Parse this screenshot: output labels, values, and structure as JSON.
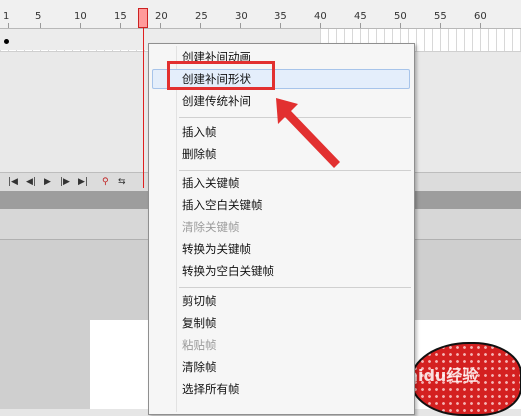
{
  "timeline": {
    "frame_numbers": [
      "1",
      "5",
      "10",
      "15",
      "20",
      "25",
      "30",
      "35",
      "40",
      "45",
      "50",
      "55",
      "60"
    ],
    "current_frame_marker": "playhead"
  },
  "controls": {
    "buttons": [
      "first-frame",
      "prev-frame",
      "play",
      "next-frame",
      "last-frame",
      "loop",
      "onion-skin"
    ]
  },
  "context_menu": {
    "groups": [
      [
        {
          "label": "创建补间动画",
          "enabled": true
        },
        {
          "label": "创建补间形状",
          "enabled": true,
          "highlighted": true
        },
        {
          "label": "创建传统补间",
          "enabled": true
        }
      ],
      [
        {
          "label": "插入帧",
          "enabled": true
        },
        {
          "label": "删除帧",
          "enabled": true
        }
      ],
      [
        {
          "label": "插入关键帧",
          "enabled": true
        },
        {
          "label": "插入空白关键帧",
          "enabled": true
        },
        {
          "label": "清除关键帧",
          "enabled": false
        },
        {
          "label": "转换为关键帧",
          "enabled": true
        },
        {
          "label": "转换为空白关键帧",
          "enabled": true
        }
      ],
      [
        {
          "label": "剪切帧",
          "enabled": true
        },
        {
          "label": "复制帧",
          "enabled": true
        },
        {
          "label": "粘贴帧",
          "enabled": false
        },
        {
          "label": "清除帧",
          "enabled": true
        },
        {
          "label": "选择所有帧",
          "enabled": true
        }
      ]
    ]
  },
  "watermark": "Baidu经验",
  "colors": {
    "annotation_red": "#e23030",
    "menu_highlight": "#e4eefb",
    "shape_fill": "#d42020"
  }
}
